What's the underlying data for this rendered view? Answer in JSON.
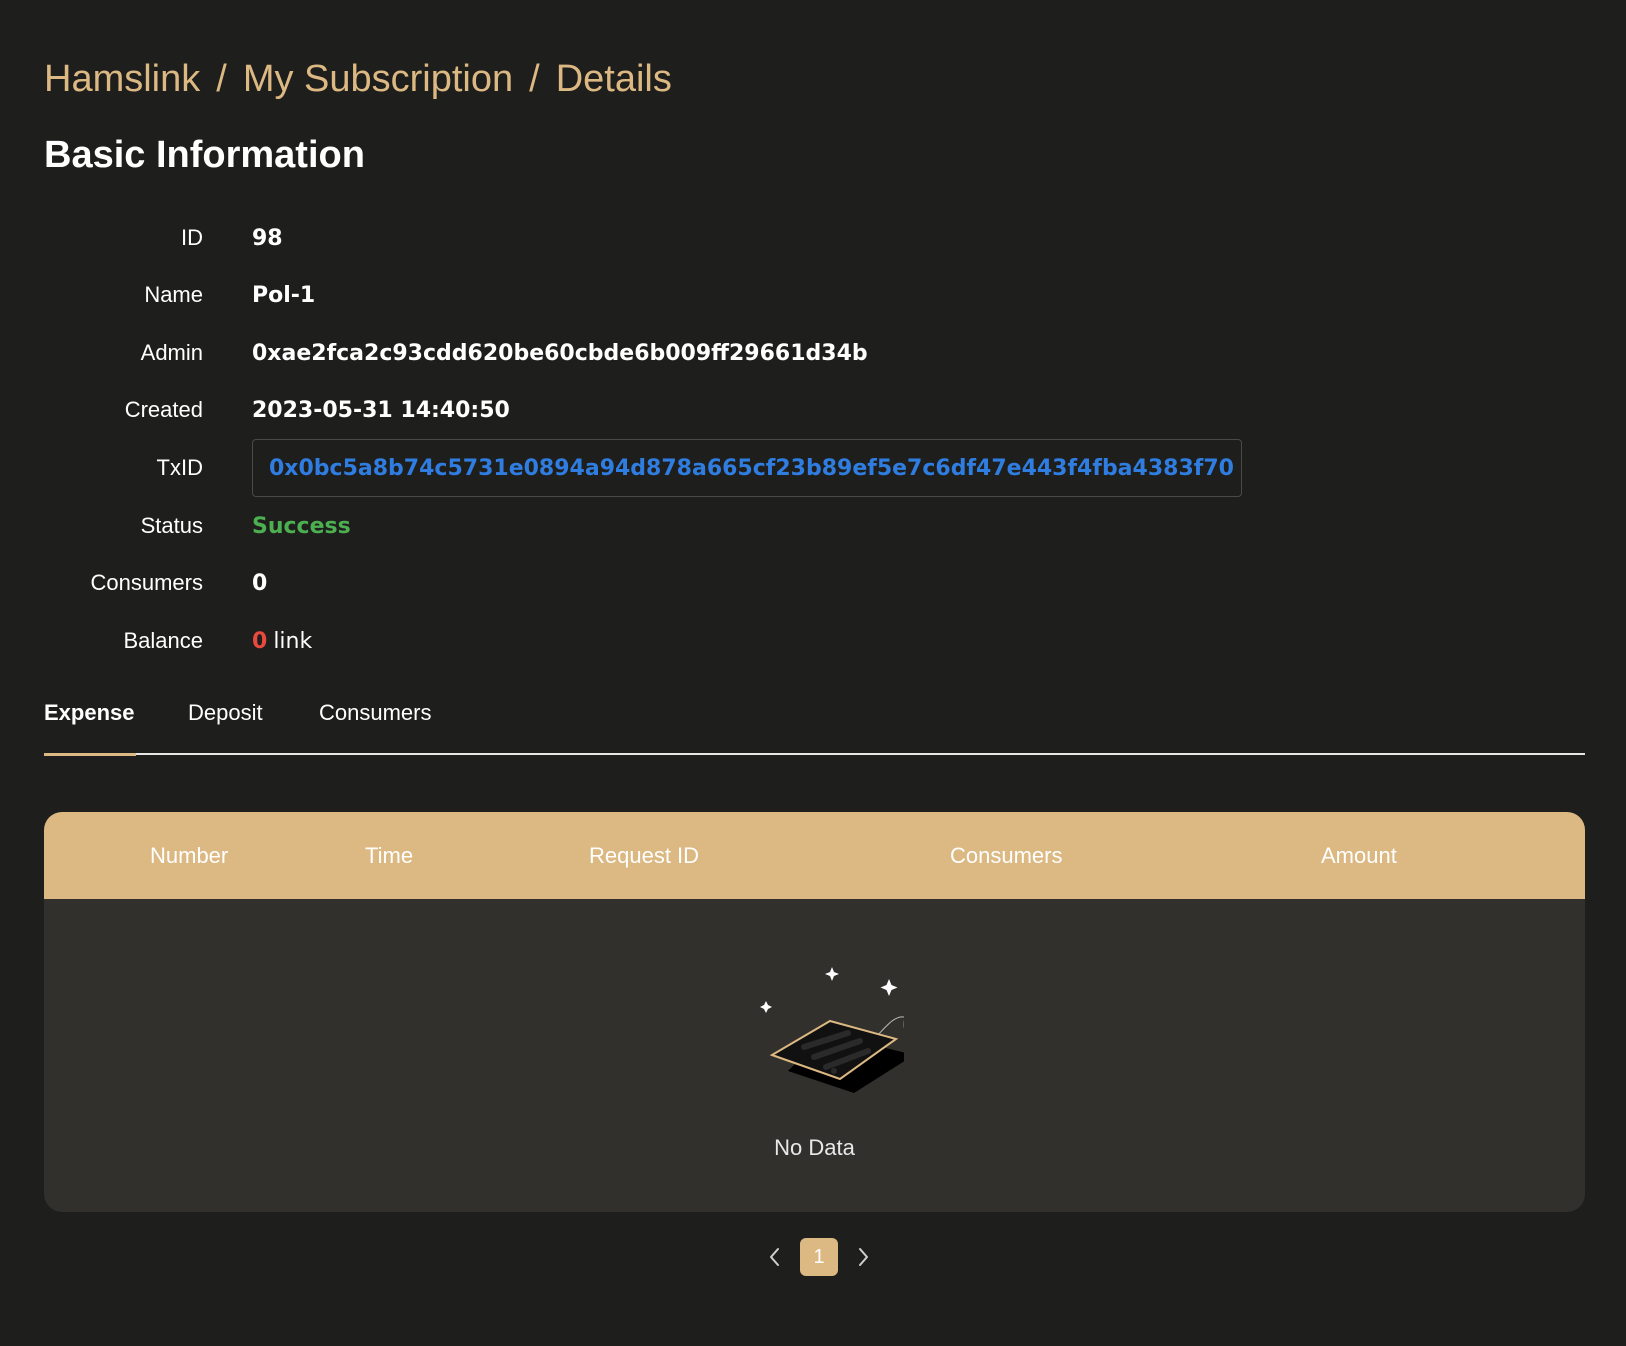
{
  "breadcrumb": {
    "items": [
      "Hamslink",
      "My Subscription",
      "Details"
    ],
    "separator": "/"
  },
  "section_title": "Basic Information",
  "info": {
    "id": {
      "label": "ID",
      "value": "98"
    },
    "name": {
      "label": "Name",
      "value": "Pol-1"
    },
    "admin": {
      "label": "Admin",
      "value": "0xae2fca2c93cdd620be60cbde6b009ff29661d34b"
    },
    "created": {
      "label": "Created",
      "value": "2023-05-31 14:40:50"
    },
    "txid": {
      "label": "TxID",
      "value": "0x0bc5a8b74c5731e0894a94d878a665cf23b89ef5e7c6df47e443f4fba4383f70",
      "icon": "link-icon"
    },
    "status": {
      "label": "Status",
      "value": "Success"
    },
    "consumers": {
      "label": "Consumers",
      "value": "0"
    },
    "balance": {
      "label": "Balance",
      "value": "0",
      "unit": "link"
    }
  },
  "tabs": [
    {
      "label": "Expense",
      "active": true
    },
    {
      "label": "Deposit",
      "active": false
    },
    {
      "label": "Consumers",
      "active": false
    }
  ],
  "table": {
    "columns": [
      "Number",
      "Time",
      "Request ID",
      "Consumers",
      "Amount"
    ],
    "rows": [],
    "empty_text": "No Data"
  },
  "pagination": {
    "current": "1",
    "prev_icon": "chevron-left-icon",
    "next_icon": "chevron-right-icon"
  },
  "colors": {
    "background": "#1e1e1d",
    "accent": "#dcb882",
    "link": "#2f7de0",
    "success": "#4caf50",
    "danger": "#e9493e",
    "table_body": "#32302c"
  }
}
